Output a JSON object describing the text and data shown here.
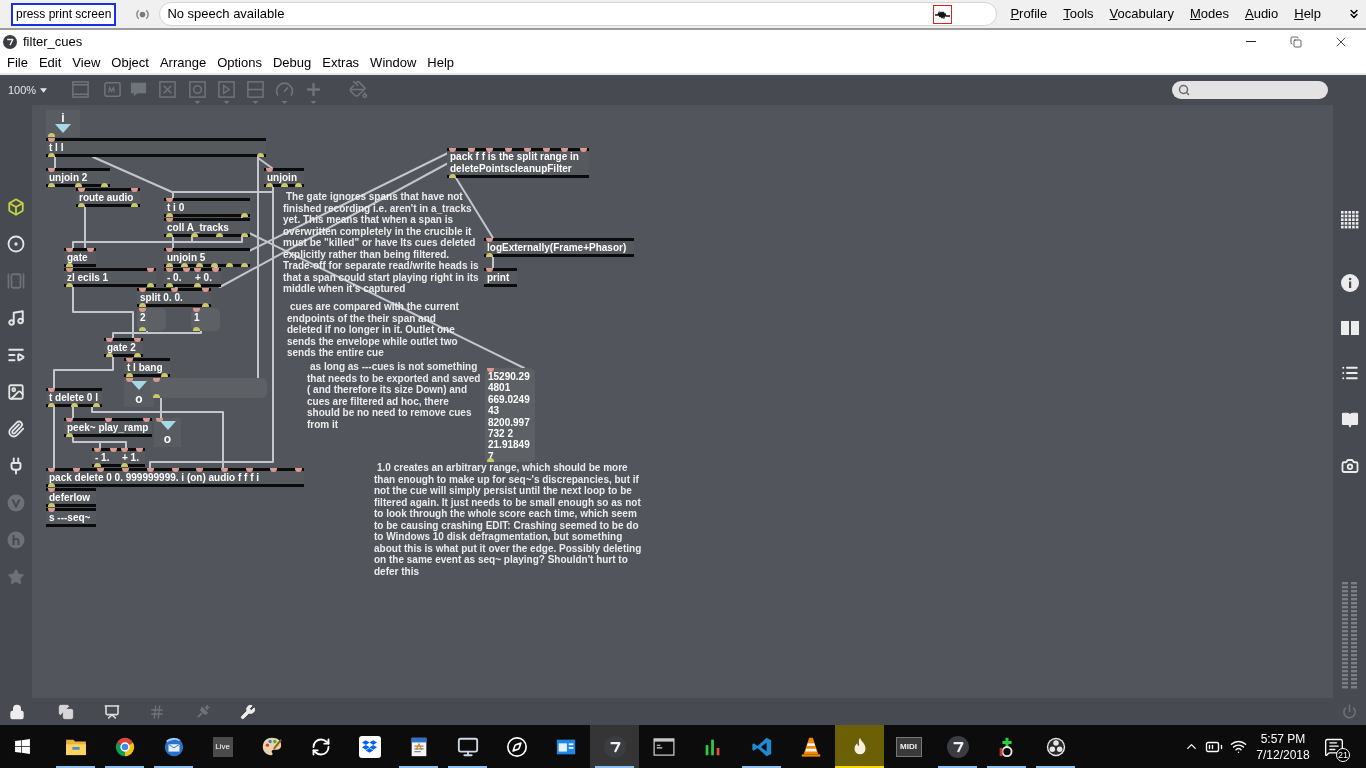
{
  "dictation_bar": {
    "status_label": "press print screen",
    "field_value": "No speech available",
    "menus": [
      "Profile",
      "Tools",
      "Vocabulary",
      "Modes",
      "Audio",
      "Help"
    ]
  },
  "window": {
    "title": "filter_cues"
  },
  "menu_bar": [
    "File",
    "Edit",
    "View",
    "Object",
    "Arrange",
    "Options",
    "Debug",
    "Extras",
    "Window",
    "Help"
  ],
  "toolbar": {
    "zoom": "100%"
  },
  "left_sidebar": [
    {
      "selected": true,
      "disabled": false
    },
    {
      "selected": false,
      "disabled": false
    },
    {
      "selected": false,
      "disabled": true
    },
    {
      "selected": false,
      "disabled": false
    },
    {
      "selected": false,
      "disabled": false
    },
    {
      "selected": false,
      "disabled": false
    },
    {
      "selected": false,
      "disabled": false
    },
    {
      "selected": false,
      "disabled": false
    },
    {
      "selected": false,
      "disabled": true
    },
    {
      "selected": false,
      "disabled": true
    },
    {
      "selected": false,
      "disabled": true
    }
  ],
  "patch": {
    "boxes": [
      {
        "kind": "inlet",
        "text": "i"
      },
      {
        "kind": "object",
        "text": "t l l"
      },
      {
        "kind": "object",
        "lines": [
          "pack f f is the split range in",
          "deletePointscleanupFilter"
        ]
      },
      {
        "kind": "object",
        "text": "unjoin 2"
      },
      {
        "kind": "object",
        "text": "unjoin"
      },
      {
        "kind": "object",
        "text": "route audio"
      },
      {
        "kind": "comment",
        "text": "The gate ignores spans that have not finished recording i.e. aren't in a_tracks yet. This means that when a span is overwritten completely in the crucible it must be \"killed\" or have Its cues deleted explicitly rather than being filtered. Trade-off for separate read/write heads is that a span could start playing right in its middle when it's captured"
      },
      {
        "kind": "object",
        "text": "t i 0"
      },
      {
        "kind": "object",
        "text": "coll A_tracks"
      },
      {
        "kind": "object",
        "text": "logExternally(Frame+Phasor)"
      },
      {
        "kind": "object",
        "text": "gate"
      },
      {
        "kind": "object",
        "text": "unjoin 5"
      },
      {
        "kind": "object",
        "text": "zl ecils 1"
      },
      {
        "kind": "object",
        "text": "- 0."
      },
      {
        "kind": "object",
        "text": "+ 0."
      },
      {
        "kind": "object",
        "text": "print"
      },
      {
        "kind": "object",
        "text": "split 0. 0."
      },
      {
        "kind": "comment",
        "text": "cues are compared with the current endpoints of the their span and deleted if no longer in it. Outlet one sends the envelope while outlet two sends the entire cue"
      },
      {
        "kind": "message",
        "text": "2"
      },
      {
        "kind": "message",
        "text": "1"
      },
      {
        "kind": "object",
        "text": "gate 2"
      },
      {
        "kind": "object",
        "text": "t l bang"
      },
      {
        "kind": "object",
        "text": "t delete 0 l"
      },
      {
        "kind": "outlet",
        "text": "o"
      },
      {
        "kind": "message"
      },
      {
        "kind": "comment",
        "text": "as long as ---cues is not something that needs to be exported and saved ( and therefore its size Down) and cues are filtered ad hoc, there should be no need to remove cues from it"
      },
      {
        "kind": "message",
        "lines": [
          "15290.29",
          "4801",
          "669.0249",
          "43",
          "8200.997",
          "732 2",
          "21.91849",
          "7"
        ]
      },
      {
        "kind": "object",
        "text": "peek~ play_ramp"
      },
      {
        "kind": "outlet",
        "text": "o"
      },
      {
        "kind": "object",
        "text": "- 1."
      },
      {
        "kind": "object",
        "text": "+ 1."
      },
      {
        "kind": "comment",
        "text": "1.0 creates an arbitrary range, which should be more than enough to make up for seq~'s discrepancies, but if not the cue will simply persist until the next loop to be filtered again. It just needs to be small enough so as not to look through the whole score each time, which seem to be causing crashing EDIT: Crashing seemed to be do to Windows 10 disk defragmentation, but something about this is what put it over the edge. Possibly deleting on the same event as seq~ playing? Shouldn't hurt to defer this"
      },
      {
        "kind": "object",
        "text": "pack delete 0 0. 999999999. i (on) audio f f f i"
      },
      {
        "kind": "object",
        "text": "deferlow"
      },
      {
        "kind": "object",
        "text": "s ---seq~"
      }
    ]
  },
  "taskbar": {
    "apps": [
      {
        "selected": false,
        "running": true,
        "attention": false
      },
      {
        "selected": false,
        "running": true,
        "attention": false
      },
      {
        "selected": false,
        "running": true,
        "attention": false
      },
      {
        "label": "Live",
        "selected": false,
        "running": false,
        "attention": false
      },
      {
        "selected": false,
        "running": false,
        "attention": false
      },
      {
        "selected": false,
        "running": false,
        "attention": false
      },
      {
        "selected": false,
        "running": false,
        "attention": false
      },
      {
        "selected": false,
        "running": true,
        "attention": false
      },
      {
        "selected": false,
        "running": true,
        "attention": false
      },
      {
        "selected": false,
        "running": false,
        "attention": false
      },
      {
        "selected": false,
        "running": false,
        "attention": false
      },
      {
        "selected": true,
        "running": true,
        "attention": false
      },
      {
        "selected": false,
        "running": false,
        "attention": false
      },
      {
        "selected": false,
        "running": false,
        "attention": false
      },
      {
        "selected": false,
        "running": true,
        "attention": false
      },
      {
        "selected": false,
        "running": false,
        "attention": false
      },
      {
        "selected": false,
        "running": true,
        "attention": true
      },
      {
        "label": "MIDI",
        "selected": false,
        "running": false,
        "attention": false
      },
      {
        "selected": false,
        "running": true,
        "attention": false
      },
      {
        "selected": false,
        "running": true,
        "attention": false
      },
      {
        "selected": false,
        "running": true,
        "attention": false
      }
    ],
    "clock": {
      "time": "5:57 PM",
      "date": "7/12/2018"
    },
    "notifications": "21"
  }
}
